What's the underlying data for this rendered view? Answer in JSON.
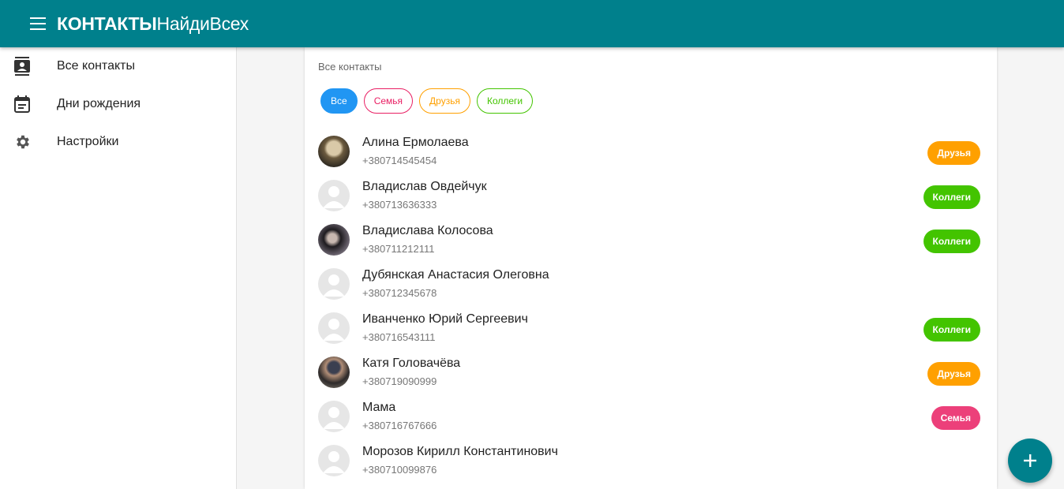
{
  "appbar": {
    "menu_icon": "menu-icon",
    "title_bold": "КОНТАКТЫ",
    "title_rest": "НайдиВсех"
  },
  "sidebar": {
    "items": [
      {
        "label": "Все контакты",
        "icon": "contacts-icon"
      },
      {
        "label": "Дни рождения",
        "icon": "calendar-icon"
      },
      {
        "label": "Настройки",
        "icon": "gear-icon"
      }
    ]
  },
  "main": {
    "title": "Все контакты",
    "filters": [
      {
        "label": "Все",
        "active": true
      },
      {
        "label": "Семья",
        "color": "#e91e63"
      },
      {
        "label": "Друзья",
        "color": "#ffa000"
      },
      {
        "label": "Коллеги",
        "color": "#43c400"
      }
    ],
    "contacts": [
      {
        "name": "Алина Ермолаева",
        "phone": "+380714545454",
        "tag": "Друзья",
        "avatar": "photo"
      },
      {
        "name": "Владислав Овдейчук",
        "phone": "+380713636333",
        "tag": "Коллеги",
        "avatar": "placeholder"
      },
      {
        "name": "Владислава Колосова",
        "phone": "+380711212111",
        "tag": "Коллеги",
        "avatar": "photo"
      },
      {
        "name": "Дубянская Анастасия Олеговна",
        "phone": "+380712345678",
        "tag": "",
        "avatar": "placeholder"
      },
      {
        "name": "Иванченко Юрий Сергеевич",
        "phone": "+380716543111",
        "tag": "Коллеги",
        "avatar": "placeholder"
      },
      {
        "name": "Катя Головачёва",
        "phone": "+380719090999",
        "tag": "Друзья",
        "avatar": "photo"
      },
      {
        "name": "Мама",
        "phone": "+380716767666",
        "tag": "Семья",
        "avatar": "placeholder"
      },
      {
        "name": "Морозов Кирилл Константинович",
        "phone": "+380710099876",
        "tag": "",
        "avatar": "placeholder"
      }
    ]
  },
  "fab": {
    "icon": "plus-icon"
  },
  "colors": {
    "primary": "#00808c",
    "active_chip": "#2196f3",
    "family": "#ec407a",
    "friends": "#ffa000",
    "colleagues": "#43c400"
  }
}
